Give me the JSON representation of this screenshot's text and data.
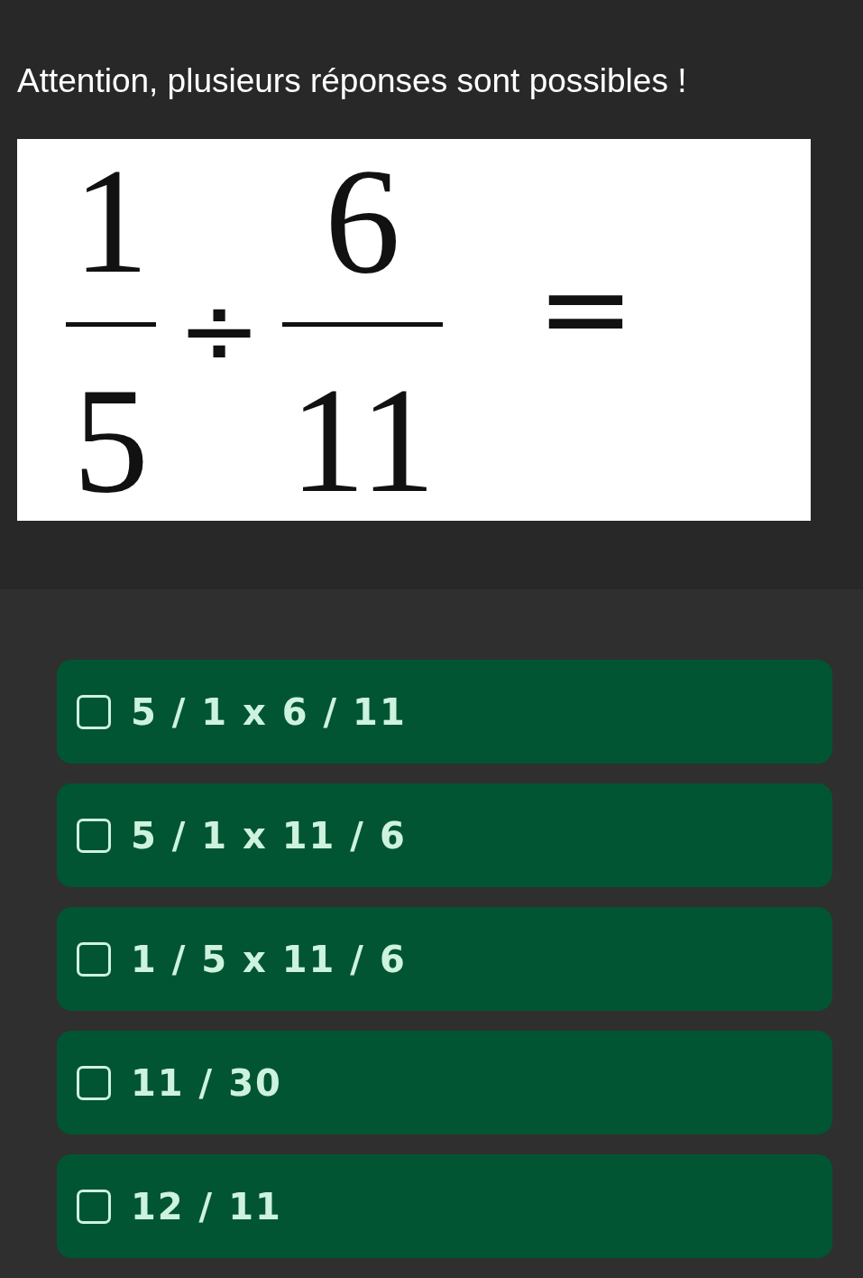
{
  "instruction": "Attention, plusieurs réponses sont possibles !",
  "equation": [
    {
      "kind": "fraction",
      "numerator": "1",
      "denominator": "5"
    },
    {
      "kind": "operator",
      "symbol": "÷"
    },
    {
      "kind": "fraction",
      "numerator": "6",
      "denominator": "11"
    },
    {
      "kind": "operator",
      "symbol": "="
    }
  ],
  "choices": [
    {
      "label": "5 / 1 x 6 / 11",
      "checked": false
    },
    {
      "label": "5 / 1 x 11 / 6",
      "checked": false
    },
    {
      "label": "1 / 5 x 11 / 6",
      "checked": false
    },
    {
      "label": "11 / 30",
      "checked": false
    },
    {
      "label": "12 / 11",
      "checked": false
    }
  ]
}
